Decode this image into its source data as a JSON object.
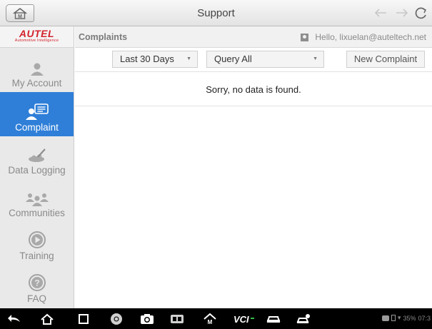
{
  "window": {
    "title": "Support"
  },
  "sidebar": {
    "brand": {
      "logo": "AUTEL",
      "tagline": "Automotive Intelligence"
    },
    "items": [
      {
        "label": "My Account",
        "icon": "user-icon",
        "active": false
      },
      {
        "label": "Complaint",
        "icon": "complaint-icon",
        "active": true
      },
      {
        "label": "Data Logging",
        "icon": "data-logging-icon",
        "active": false
      },
      {
        "label": "Communities",
        "icon": "communities-icon",
        "active": false
      },
      {
        "label": "Training",
        "icon": "play-icon",
        "active": false
      },
      {
        "label": "FAQ",
        "icon": "question-icon",
        "active": false
      }
    ]
  },
  "main": {
    "breadcrumb": "Complaints",
    "greeting": "Hello, lixuelan@auteltech.net",
    "filters": {
      "date_range": "Last 30 Days",
      "query": "Query All"
    },
    "new_button": "New Complaint",
    "empty_message": "Sorry, no data is found."
  },
  "system_bar": {
    "status_text": "35%",
    "clock": "07:3"
  },
  "colors": {
    "accent": "#2f7fd8",
    "brand_red": "#d4232c",
    "sidebar_bg": "#e9e9e9",
    "sysbar_bg": "#000000"
  }
}
